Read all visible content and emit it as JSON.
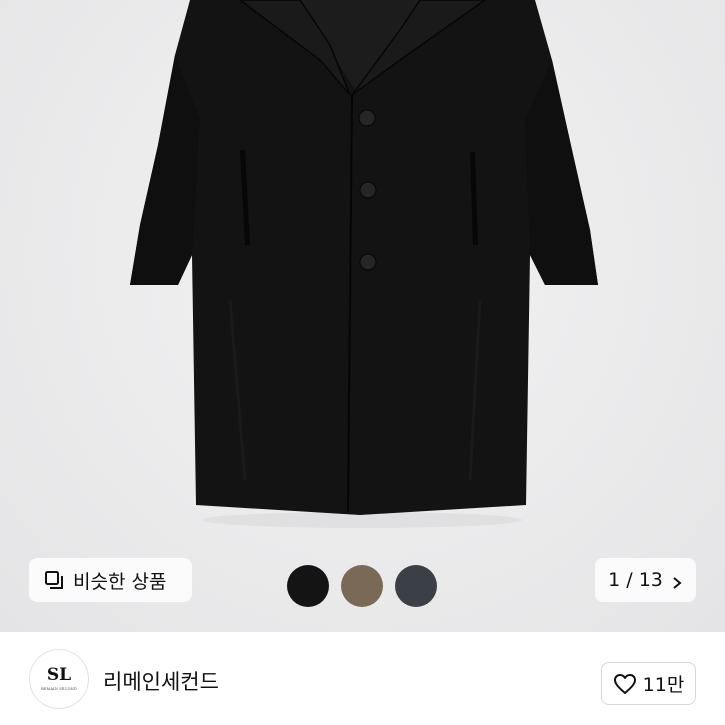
{
  "product": {
    "image_alt": "black wool long coat",
    "similar_button_label": "비슷한 상품",
    "similar_icon": "stack-icon",
    "color_swatches": [
      {
        "name": "black",
        "color": "#141414"
      },
      {
        "name": "brown",
        "color": "#7a6956"
      },
      {
        "name": "charcoal",
        "color": "#3b4046"
      }
    ],
    "page_indicator": "1 / 13",
    "next_icon": "chevron-right-icon"
  },
  "store": {
    "logo_monogram": "SL",
    "logo_text": "REMAIN SECOND",
    "name": "리메인세컨드",
    "like_icon": "heart-icon",
    "like_count": "11만"
  }
}
